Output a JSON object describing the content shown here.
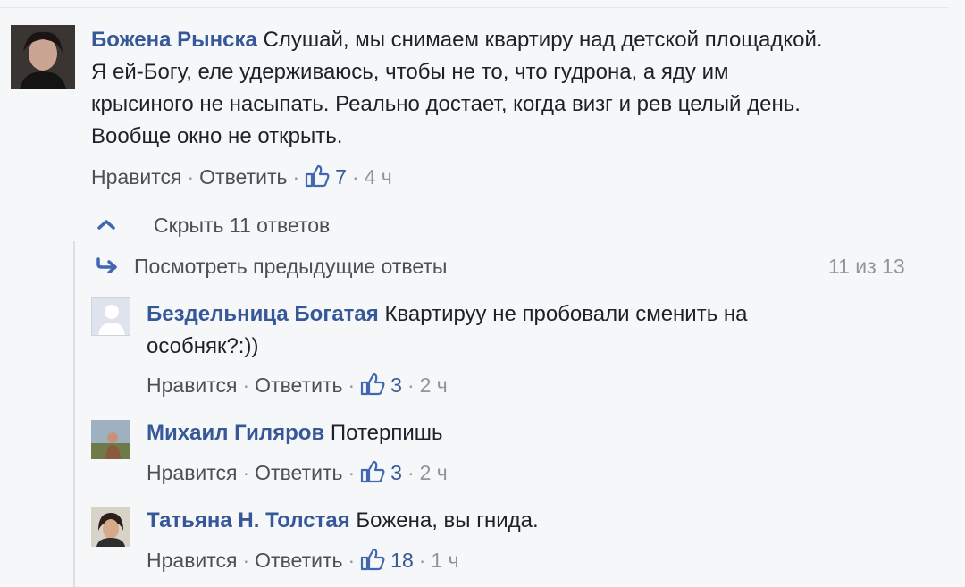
{
  "main_comment": {
    "author": "Божена Рынска",
    "text_lines": [
      "Слушай, мы снимаем квартиру над детской площадкой.",
      "Я ей-Богу, еле удерживаюсь, чтобы не то, что гудрона, а яду им",
      "крысиного не насыпать. Реально достает, когда визг и рев целый день.",
      "Вообще окно не открыть."
    ],
    "like_label": "Нравится",
    "reply_label": "Ответить",
    "likes": "7",
    "time": "4 ч"
  },
  "replies_toggle": {
    "label": "Скрыть 11 ответов",
    "icon": "chevron-up-icon"
  },
  "previous_replies": {
    "label": "Посмотреть предыдущие ответы",
    "counter": "11 из 13",
    "icon": "reply-arrow-icon"
  },
  "replies": [
    {
      "author": "Бездельница Богатая",
      "text_line1": "Квартируу не пробовали сменить на",
      "text_line2": "особняк?:))",
      "like_label": "Нравится",
      "reply_label": "Ответить",
      "likes": "3",
      "time": "2 ч"
    },
    {
      "author": "Михаил Гиляров",
      "text": "Потерпишь",
      "like_label": "Нравится",
      "reply_label": "Ответить",
      "likes": "3",
      "time": "2 ч"
    },
    {
      "author": "Татьяна Н. Толстая",
      "text": "Божена, вы гнида.",
      "like_label": "Нравится",
      "reply_label": "Ответить",
      "likes": "18",
      "time": "1 ч"
    }
  ],
  "colors": {
    "author": "#365899",
    "link": "#4b4f56",
    "muted": "#90949c",
    "background": "#f6f7f9"
  }
}
